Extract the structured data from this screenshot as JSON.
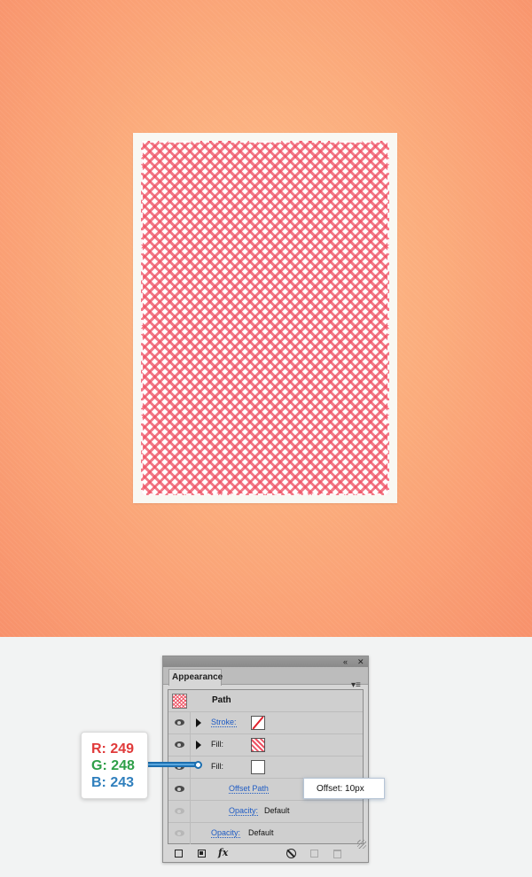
{
  "artwork": {
    "background_color": "#fbac7c",
    "card_color": "#f9f8f3",
    "pattern_color": "#ef5264"
  },
  "panel": {
    "tab_label": "Appearance",
    "collapse_glyph": "«",
    "close_glyph": "✕",
    "menu_glyph": "▾≡",
    "title": "Path",
    "rows": {
      "stroke": {
        "label": "Stroke:"
      },
      "fill1": {
        "label": "Fill:"
      },
      "fill2": {
        "label": "Fill:"
      },
      "offset": {
        "label": "Offset Path"
      },
      "inner_opacity": {
        "label": "Opacity:",
        "value": "Default"
      },
      "opacity": {
        "label": "Opacity:",
        "value": "Default"
      }
    },
    "footer": {
      "fx_label": "fx"
    }
  },
  "tooltip": {
    "text": "Offset: 10px"
  },
  "rgb": {
    "r": "R: 249",
    "g": "G: 248",
    "b": "B: 243"
  }
}
